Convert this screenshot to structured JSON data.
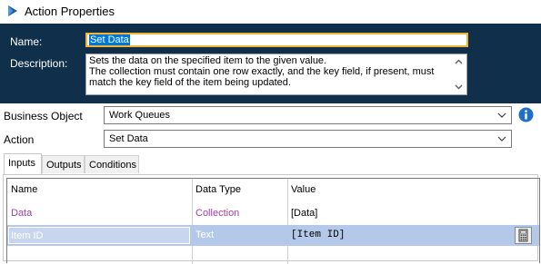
{
  "window": {
    "title": "Action Properties"
  },
  "header": {
    "name_label": "Name:",
    "name_value": "Set Data",
    "description_label": "Description:",
    "description_lines": [
      "Sets the data on the specified item to the given value.",
      "The collection must contain one row exactly, and the key field, if present, must",
      "match the key field of the item being updated."
    ]
  },
  "business_object": {
    "label": "Business Object",
    "value": "Work Queues"
  },
  "action": {
    "label": "Action",
    "value": "Set Data"
  },
  "tabs": [
    {
      "label": "Inputs",
      "active": true
    },
    {
      "label": "Outputs",
      "active": false
    },
    {
      "label": "Conditions",
      "active": false
    }
  ],
  "grid": {
    "columns": [
      "Name",
      "Data Type",
      "Value"
    ],
    "rows": [
      {
        "name": "Data",
        "type": "Collection",
        "value": "[Data]",
        "selected": false
      },
      {
        "name": "Item ID",
        "type": "Text",
        "value": "[Item ID]",
        "selected": true
      }
    ]
  },
  "colors": {
    "header_bg": "#0f2f4b",
    "name_focus_border": "#f2b233",
    "collection_text": "#a040a0",
    "selected_row": "#b4c9e9",
    "info_blue": "#1e6fc8"
  }
}
